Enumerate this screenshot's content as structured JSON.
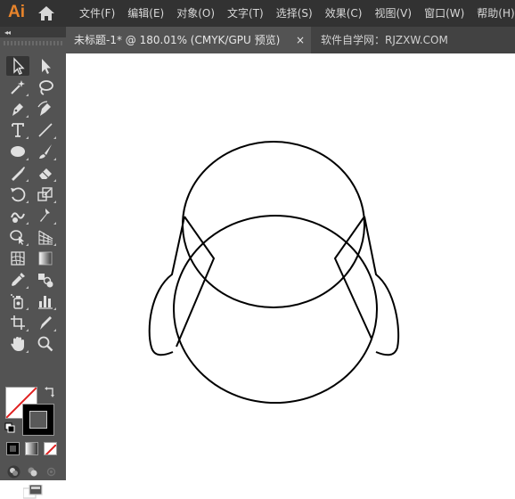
{
  "app": {
    "logo": "Ai"
  },
  "menu": {
    "items": [
      "文件(F)",
      "编辑(E)",
      "对象(O)",
      "文字(T)",
      "选择(S)",
      "效果(C)",
      "视图(V)",
      "窗口(W)",
      "帮助(H)"
    ]
  },
  "tabs": {
    "active": "未标题-1* @ 180.01% (CMYK/GPU 预览)",
    "close": "×",
    "inactive": "软件自学网：RJZXW.COM"
  },
  "colors": {
    "menubar": "#323232",
    "panel": "#535353",
    "accent": "#e8842b",
    "stroke": "#000000",
    "fill": "#ffffff"
  },
  "tools": [
    "selection-tool-icon",
    "direct-selection-tool-icon",
    "magic-wand-tool-icon",
    "lasso-tool-icon",
    "pen-tool-icon",
    "curvature-tool-icon",
    "type-tool-icon",
    "line-tool-icon",
    "ellipse-tool-icon",
    "paintbrush-tool-icon",
    "shaper-tool-icon",
    "eraser-tool-icon",
    "rotate-tool-icon",
    "scale-tool-icon",
    "warp-tool-icon",
    "puppet-warp-tool-icon",
    "shape-builder-tool-icon",
    "perspective-grid-tool-icon",
    "mesh-tool-icon",
    "gradient-tool-icon",
    "eyedropper-tool-icon",
    "blend-tool-icon",
    "symbol-sprayer-tool-icon",
    "column-graph-tool-icon",
    "artboard-tool-icon",
    "slice-tool-icon",
    "hand-tool-icon",
    "zoom-tool-icon"
  ]
}
